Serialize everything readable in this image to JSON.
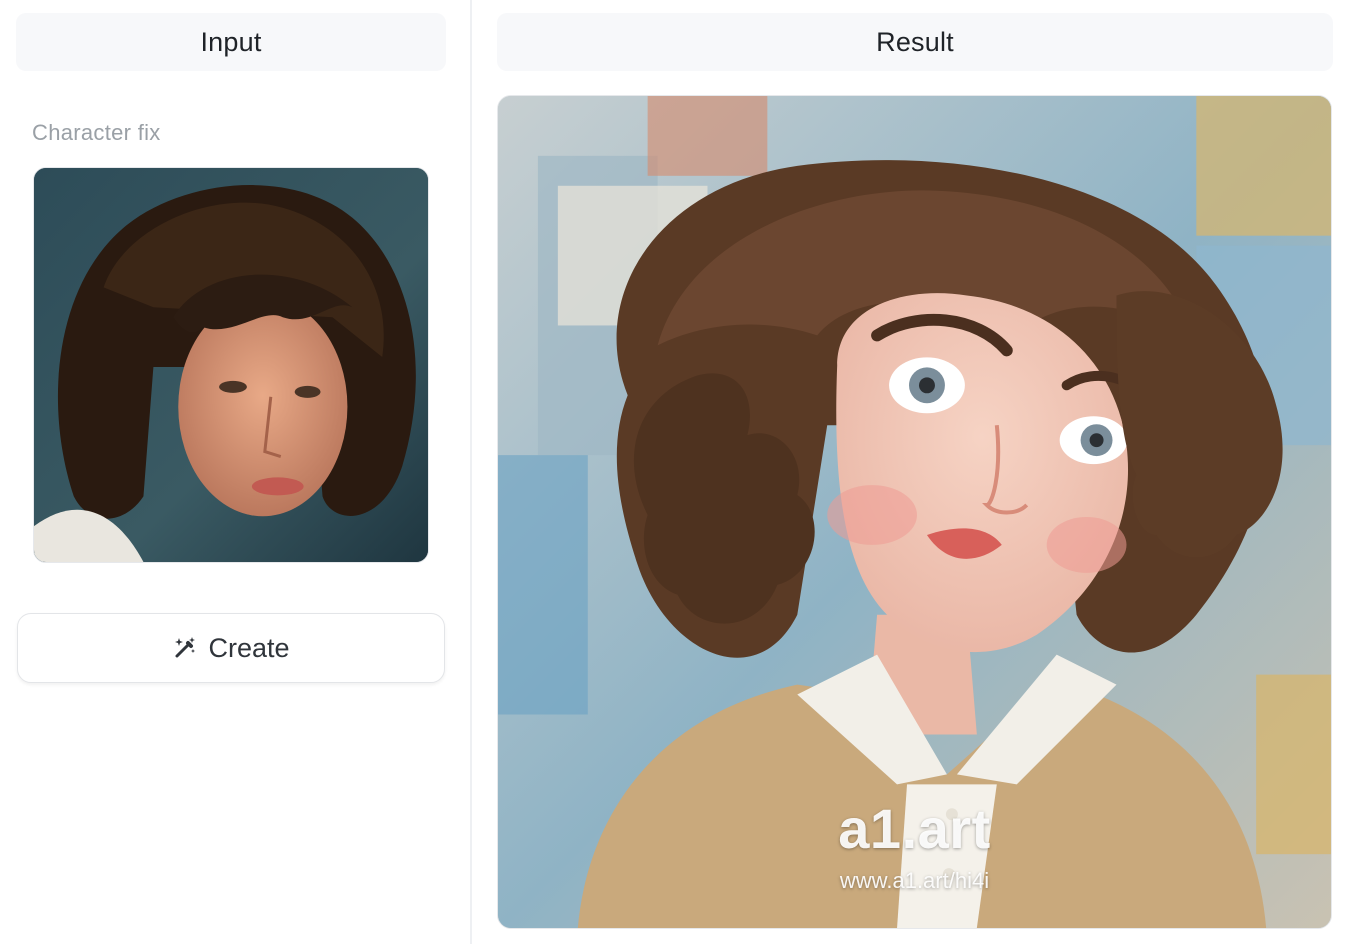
{
  "input_panel": {
    "header": "Input",
    "field_label": "Character fix",
    "image_alt": "Input photo of a woman with curly brown hair",
    "create_button_label": "Create",
    "create_icon": "magic-wand-icon"
  },
  "result_panel": {
    "header": "Result",
    "image_alt": "Cartoon-style rendering of a woman with wavy brown hair in a beige cardigan",
    "watermark_brand": "a1.art",
    "watermark_url": "www.a1.art/hi4i"
  },
  "colors": {
    "header_bg": "#f7f8fa",
    "label_gray": "#9aa0a6",
    "border": "#e3e5e8",
    "text": "#1f2328"
  }
}
